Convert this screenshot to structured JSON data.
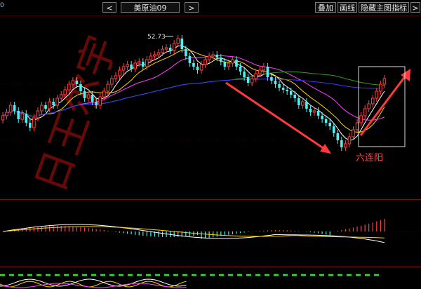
{
  "toolbar": {
    "prev_label": "<",
    "symbol": "美原油09",
    "next_label": ">",
    "overlay_label": "叠加",
    "draw_label": "画线",
    "hide_indicator_label": "隐藏主图指标",
    "more_label": ">",
    "left_tag": "0"
  },
  "main_chart": {
    "high_price_label": "52.73",
    "annotation_text": "六连阳"
  },
  "watermark": "日王尔宇",
  "colors": {
    "up": "#ff4040",
    "down": "#4ff0f0",
    "arrow": "#ff3a3a",
    "ma5": "#ffffff",
    "ma10": "#ffd700",
    "ma20": "#ff40ff",
    "ma60": "#2a9a2a",
    "ma120": "#3a3aff"
  },
  "icons": [
    "arrow-up-right-icon",
    "arrow-down-right-icon"
  ]
}
